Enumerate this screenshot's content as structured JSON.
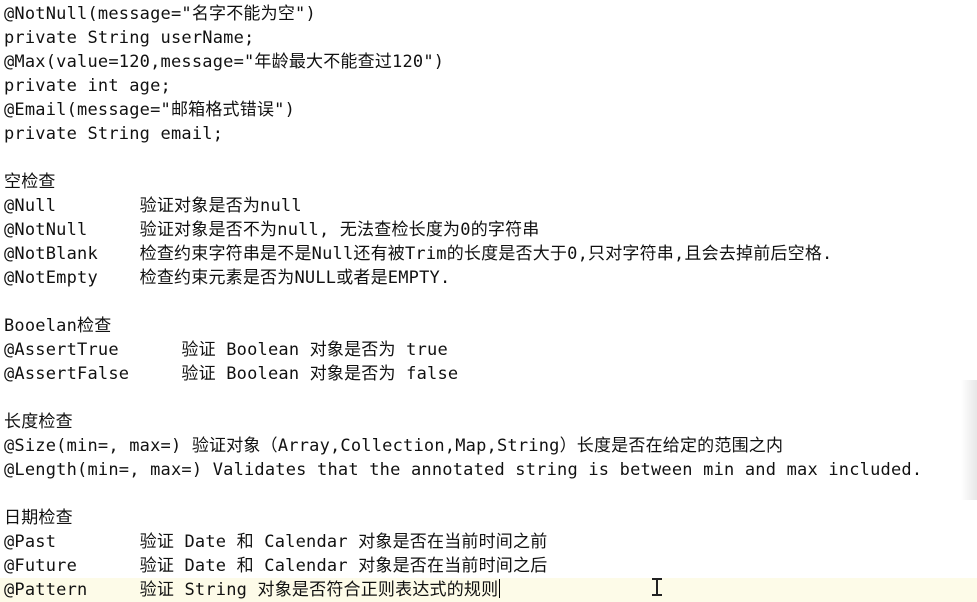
{
  "editor": {
    "lines": [
      "@NotNull(message=\"名字不能为空\")",
      "private String userName;",
      "@Max(value=120,message=\"年龄最大不能查过120\")",
      "private int age;",
      "@Email(message=\"邮箱格式错误\")",
      "private String email;",
      "",
      "空检查",
      "@Null        验证对象是否为null",
      "@NotNull     验证对象是否不为null, 无法查检长度为0的字符串",
      "@NotBlank    检查约束字符串是不是Null还有被Trim的长度是否大于0,只对字符串,且会去掉前后空格.",
      "@NotEmpty    检查约束元素是否为NULL或者是EMPTY.",
      "",
      "Booelan检查",
      "@AssertTrue      验证 Boolean 对象是否为 true",
      "@AssertFalse     验证 Boolean 对象是否为 false",
      "",
      "长度检查",
      "@Size(min=, max=) 验证对象（Array,Collection,Map,String）长度是否在给定的范围之内",
      "@Length(min=, max=) Validates that the annotated string is between min and max included.",
      "",
      "日期检查",
      "@Past        验证 Date 和 Calendar 对象是否在当前时间之前",
      "@Future      验证 Date 和 Calendar 对象是否在当前时间之后",
      "@Pattern     验证 String 对象是否符合正则表达式的规则"
    ]
  }
}
